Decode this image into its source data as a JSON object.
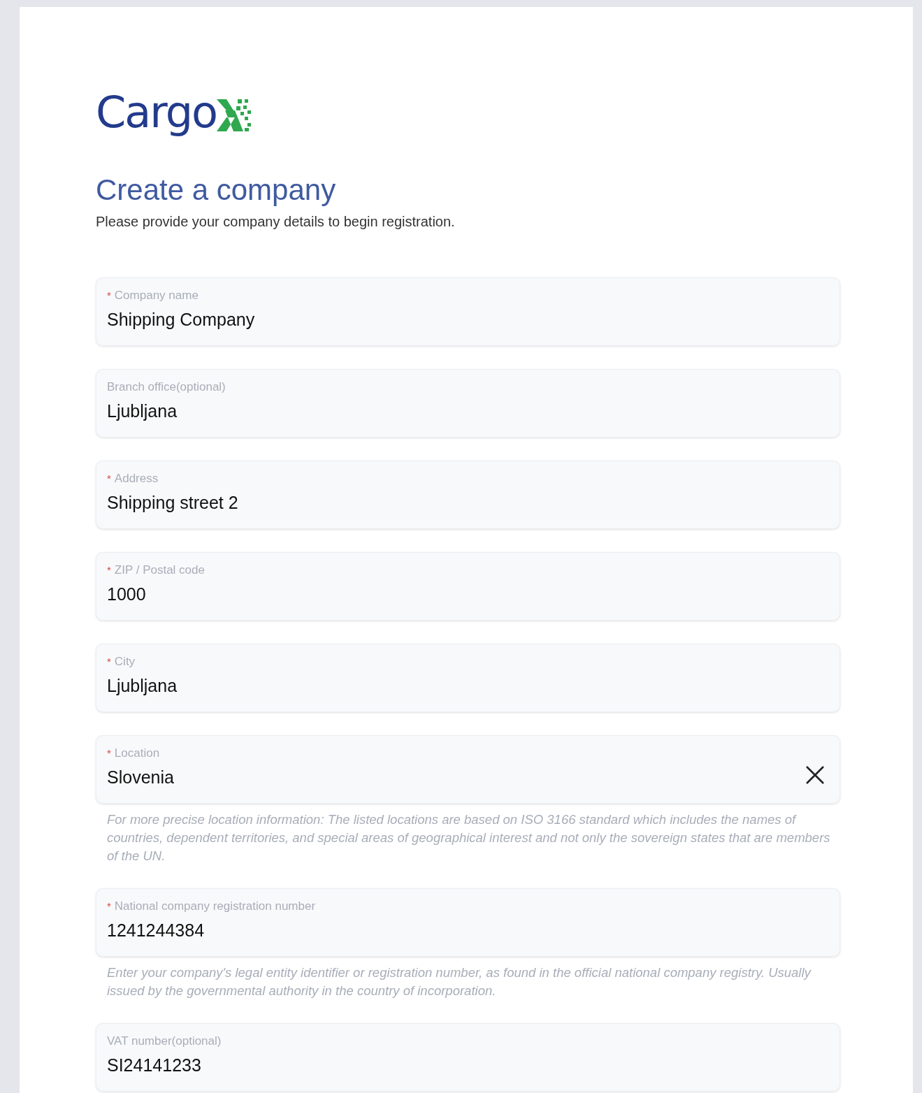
{
  "logo": {
    "text": "Cargo"
  },
  "title": "Create a company",
  "subtitle": "Please provide your company details to begin registration.",
  "required_mark": "*",
  "fields": [
    {
      "label": "Company name",
      "value": "Shipping Company",
      "required": true,
      "clearable": false
    },
    {
      "label": "Branch office(optional)",
      "value": "Ljubljana",
      "required": false,
      "clearable": false
    },
    {
      "label": "Address",
      "value": "Shipping street 2",
      "required": true,
      "clearable": false
    },
    {
      "label": "ZIP / Postal code",
      "value": "1000",
      "required": true,
      "clearable": false
    },
    {
      "label": "City",
      "value": "Ljubljana",
      "required": true,
      "clearable": false
    },
    {
      "label": "Location",
      "value": "Slovenia",
      "required": true,
      "clearable": true,
      "hint": "For more precise location information: The listed locations are based on ISO 3166 standard which includes the names of countries, dependent territories, and special areas of geographical interest and not only the sovereign states that are members of the UN."
    },
    {
      "label": "National company registration number",
      "value": "1241244384",
      "required": true,
      "clearable": false,
      "hint": "Enter your company's legal entity identifier or registration number, as found in the official national company registry. Usually issued by the governmental authority in the country of incorporation."
    },
    {
      "label": "VAT number(optional)",
      "value": "SI24141233",
      "required": false,
      "clearable": false
    }
  ]
}
